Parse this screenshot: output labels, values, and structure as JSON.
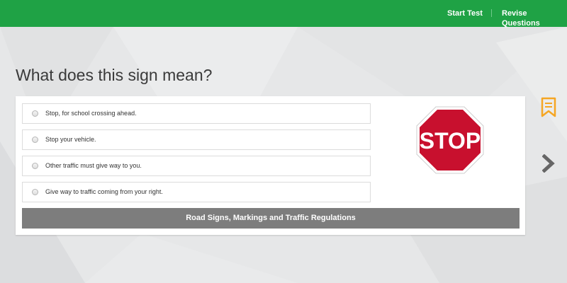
{
  "header": {
    "start_test": "Start Test",
    "revise_questions": "Revise Questions",
    "accent_color": "#1fa245"
  },
  "question": {
    "title": "What does this sign mean?",
    "options": [
      {
        "label": "Stop, for school crossing ahead."
      },
      {
        "label": "Stop your vehicle."
      },
      {
        "label": "Other traffic must give way to you."
      },
      {
        "label": "Give way to traffic coming from your right."
      }
    ],
    "sign": {
      "text": "STOP",
      "icon": "stop-sign-icon",
      "color": "#c8102e"
    },
    "category": "Road Signs, Markings and Traffic Regulations"
  },
  "side": {
    "bookmark_icon": "bookmark-icon",
    "bookmark_color": "#f5a623",
    "next_icon": "chevron-right-icon"
  }
}
